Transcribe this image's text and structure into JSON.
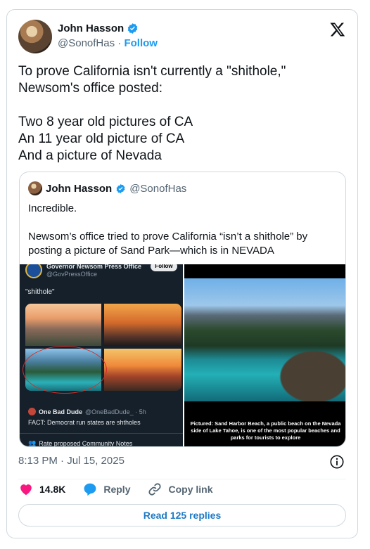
{
  "tweet": {
    "author_name": "John Hasson",
    "author_handle": "@SonofHas",
    "follow_label": "Follow",
    "text": "To prove California isn't currently a \"shithole,\"\nNewsom's office posted:\n\nTwo 8 year old pictures of CA\nAn 11 year old picture of CA\nAnd a picture of Nevada",
    "timestamp": "8:13 PM · Jul 15, 2025",
    "likes": "14.8K",
    "reply_label": "Reply",
    "copy_link_label": "Copy link",
    "read_replies_label": "Read 125 replies"
  },
  "quote": {
    "author_name": "John Hasson",
    "author_handle": "@SonofHas",
    "line1": "Incredible.",
    "line2": "Newsom’s office tried to prove California “isn’t a shithole” by posting a picture of Sand Park—which is in NEVADA"
  },
  "embedded_left": {
    "account_name": "Governor Newsom Press Office",
    "account_handle": "@GovPressOffice",
    "follow_label": "Follow",
    "post_text": "\"shithole\"",
    "reply_name": "One Bad Dude",
    "reply_handle": "@OneBadDude_ · 5h",
    "reply_text": "FACT: Democrat run states are shtholes",
    "community_notes": "Rate proposed Community Notes"
  },
  "embedded_right": {
    "caption": "Pictured: Sand Harbor Beach, a public beach on the Nevada side of Lake Tahoe, is one of the most popular beaches and parks for tourists to explore"
  },
  "colors": {
    "accent": "#1d9bf0",
    "like": "#f91880",
    "text": "#0f1419",
    "muted": "#536471"
  },
  "icons": [
    "x-logo-icon",
    "verified-badge-icon",
    "heart-icon",
    "reply-icon",
    "link-icon",
    "info-icon"
  ]
}
